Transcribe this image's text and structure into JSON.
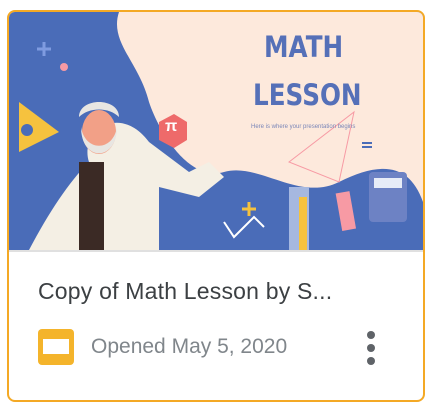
{
  "file": {
    "title": "Copy of Math Lesson by S...",
    "opened_label": "Opened",
    "opened_date": "May 5, 2020",
    "file_type_icon": "google-slides-icon",
    "more_icon": "more-vert-icon"
  },
  "thumbnail": {
    "title_line1": "MATH",
    "title_line2": "LESSON",
    "subtitle": "Here is where your presentation begins",
    "pi_symbol": "π"
  },
  "colors": {
    "card_border": "#f4a925",
    "slides_icon": "#f4b42b",
    "thumb_bg": "#4a6cb8",
    "thumb_bubble": "#fde9dc"
  }
}
